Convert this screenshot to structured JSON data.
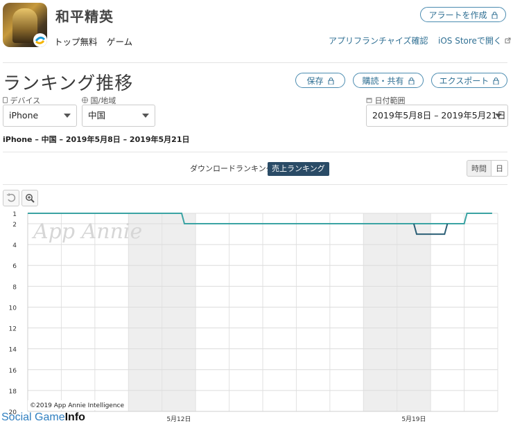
{
  "app": {
    "title": "和平精英",
    "category_rank": "トップ無料",
    "genre": "ゲーム",
    "create_alert_label": "アラートを作成",
    "franchise_link": "アプリフランチャイズ確認",
    "store_link": "iOS Storeで開く"
  },
  "section": {
    "title": "ランキング推移",
    "save_label": "保存",
    "subscribe_label": "購読・共有",
    "export_label": "エクスポート"
  },
  "filters": {
    "device_label": "デバイス",
    "device_value": "iPhone",
    "country_label": "国/地域",
    "country_value": "中国",
    "date_label": "日付範囲",
    "date_value": "2019年5月8日 – 2019年5月21日"
  },
  "summary": "iPhone – 中国 – 2019年5月8日 – 2019年5月21日",
  "ranking_tabs": {
    "download": "ダウンロードランキング",
    "revenue": "売上ランキング",
    "active": "revenue"
  },
  "granularity": {
    "hour": "時間",
    "day": "日",
    "active": "hour"
  },
  "colors": {
    "accent": "#2f6f93",
    "series_light": "#3aa3a3",
    "series_dark": "#2a5e75",
    "weekend_band": "#eeeeee"
  },
  "chart_data": {
    "type": "line",
    "yaxis_reversed": true,
    "y_ticks": [
      1,
      2,
      4,
      6,
      8,
      10,
      12,
      14,
      16,
      18,
      20
    ],
    "ylim": [
      1,
      20
    ],
    "x_tick_labels": [
      "5月12日",
      "5月19日"
    ],
    "weekend_bands": [
      [
        "2019-05-11",
        "2019-05-12"
      ],
      [
        "2019-05-18",
        "2019-05-19"
      ]
    ],
    "series": [
      {
        "color": "#3aa3a3",
        "x": [
          "2019-05-08 00:00",
          "2019-05-09 12:00",
          "2019-05-11 00:00",
          "2019-05-12 14:00",
          "2019-05-12 16:00",
          "2019-05-19 00:00",
          "2019-05-20 00:00",
          "2019-05-21 00:00",
          "2019-05-21 02:00",
          "2019-05-21 20:00"
        ],
        "y": [
          1,
          1,
          1,
          1,
          2,
          2,
          2,
          2,
          1,
          1
        ]
      },
      {
        "color": "#2a5e75",
        "x": [
          "2019-05-19 12:00",
          "2019-05-19 14:00",
          "2019-05-20 10:00",
          "2019-05-20 12:00"
        ],
        "y": [
          2,
          3,
          3,
          2
        ]
      }
    ],
    "watermark": "App Annie",
    "copyright": "©2019 App Annie Intelligence"
  },
  "footer_watermark": {
    "part1": "Social Game",
    "part2": "Info"
  }
}
